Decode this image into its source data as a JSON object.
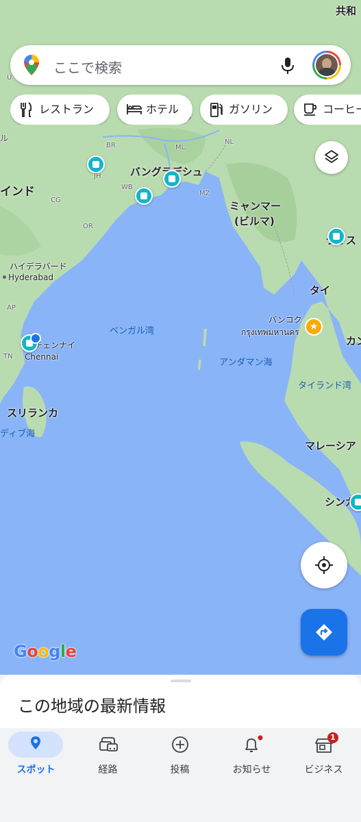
{
  "search": {
    "placeholder": "ここで検索"
  },
  "chips": [
    {
      "label": "レストラン",
      "icon": "restaurant-icon"
    },
    {
      "label": "ホテル",
      "icon": "hotel-icon"
    },
    {
      "label": "ガソリン",
      "icon": "gas-station-icon"
    },
    {
      "label": "コーヒー",
      "icon": "coffee-icon"
    }
  ],
  "map": {
    "labels": {
      "india": "インド",
      "bangladesh": "バングラデシュ",
      "myanmar_1": "ミャンマー",
      "myanmar_2": "(ビルマ)",
      "hyderabad_ja": "ハイデラバード",
      "hyderabad_en": "Hyderabad",
      "chennai_ja": "チェンナイ",
      "chennai_en": "Chennai",
      "srilanka": "スリランカ",
      "bay_of_bengal": "ベンガル湾",
      "andaman_sea": "アンダマン海",
      "gulf_of_thailand": "タイランド湾",
      "maldives_sea": "ディブ海",
      "thailand": "タイ",
      "bangkok_ja": "バンコク",
      "bangkok_th": "กรุงเทพมหานคร",
      "malaysia": "マレーシア",
      "singapore": "シンガ",
      "cambodia": "カン",
      "laos": "ラオス",
      "china": "共和",
      "state_br": "BR",
      "state_jh": "JH",
      "state_wb": "WB",
      "state_cg": "CG",
      "state_or": "OR",
      "state_ap": "AP",
      "state_tn": "TN",
      "state_ml": "ML",
      "state_nl": "NL",
      "state_mz": "MZ",
      "edge_ul": "ル",
      "edge_u": "U",
      "edge_n": "ン"
    },
    "google_logo": "Google"
  },
  "sheet": {
    "title": "この地域の最新情報"
  },
  "nav": [
    {
      "label": "スポット",
      "icon": "explore-pin-icon",
      "active": true
    },
    {
      "label": "経路",
      "icon": "commute-icon",
      "active": false
    },
    {
      "label": "投稿",
      "icon": "contribute-icon",
      "active": false
    },
    {
      "label": "お知らせ",
      "icon": "bell-icon",
      "active": false
    },
    {
      "label": "ビジネス",
      "icon": "business-icon",
      "active": false,
      "badge": "1"
    }
  ],
  "colors": {
    "water": "#8ab4f8",
    "land": "#b9dbb0",
    "accent": "#1a73e8",
    "poi": "#12b5cb",
    "badge": "#c5221f"
  }
}
